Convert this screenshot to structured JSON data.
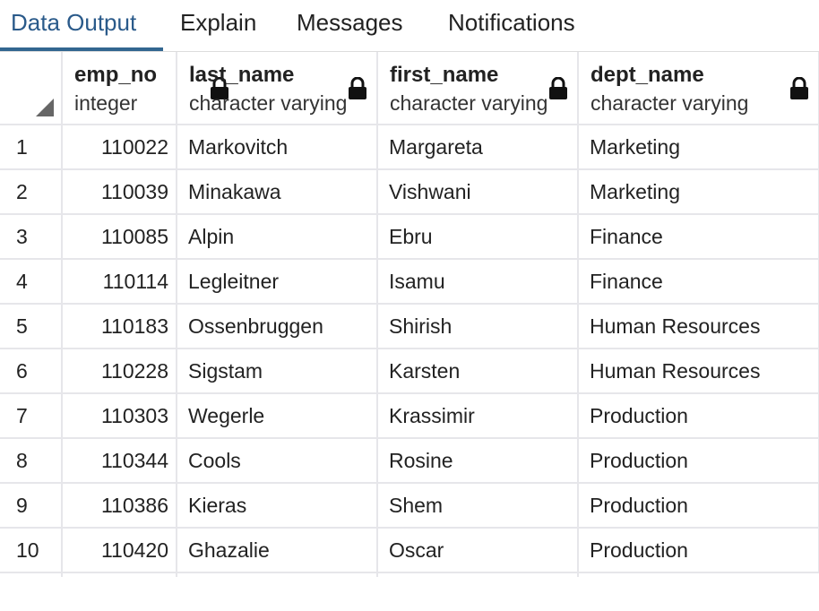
{
  "tabs": [
    {
      "label": "Data Output",
      "active": true
    },
    {
      "label": "Explain",
      "active": false
    },
    {
      "label": "Messages",
      "active": false
    },
    {
      "label": "Notifications",
      "active": false
    }
  ],
  "columns": [
    {
      "name": "emp_no",
      "type": "integer",
      "icon": "lock-icon"
    },
    {
      "name": "last_name",
      "type": "character varying",
      "icon": "lock-icon"
    },
    {
      "name": "first_name",
      "type": "character varying",
      "icon": "lock-icon"
    },
    {
      "name": "dept_name",
      "type": "character varying",
      "icon": "lock-icon"
    }
  ],
  "rows": [
    {
      "n": "1",
      "emp_no": "110022",
      "last_name": "Markovitch",
      "first_name": "Margareta",
      "dept_name": "Marketing"
    },
    {
      "n": "2",
      "emp_no": "110039",
      "last_name": "Minakawa",
      "first_name": "Vishwani",
      "dept_name": "Marketing"
    },
    {
      "n": "3",
      "emp_no": "110085",
      "last_name": "Alpin",
      "first_name": "Ebru",
      "dept_name": "Finance"
    },
    {
      "n": "4",
      "emp_no": "110114",
      "last_name": "Legleitner",
      "first_name": "Isamu",
      "dept_name": "Finance"
    },
    {
      "n": "5",
      "emp_no": "110183",
      "last_name": "Ossenbruggen",
      "first_name": "Shirish",
      "dept_name": "Human Resources"
    },
    {
      "n": "6",
      "emp_no": "110228",
      "last_name": "Sigstam",
      "first_name": "Karsten",
      "dept_name": "Human Resources"
    },
    {
      "n": "7",
      "emp_no": "110303",
      "last_name": "Wegerle",
      "first_name": "Krassimir",
      "dept_name": "Production"
    },
    {
      "n": "8",
      "emp_no": "110344",
      "last_name": "Cools",
      "first_name": "Rosine",
      "dept_name": "Production"
    },
    {
      "n": "9",
      "emp_no": "110386",
      "last_name": "Kieras",
      "first_name": "Shem",
      "dept_name": "Production"
    },
    {
      "n": "10",
      "emp_no": "110420",
      "last_name": "Ghazalie",
      "first_name": "Oscar",
      "dept_name": "Production"
    }
  ],
  "colors": {
    "active_tab": "#326690",
    "grid_line": "#e6e6ea"
  }
}
